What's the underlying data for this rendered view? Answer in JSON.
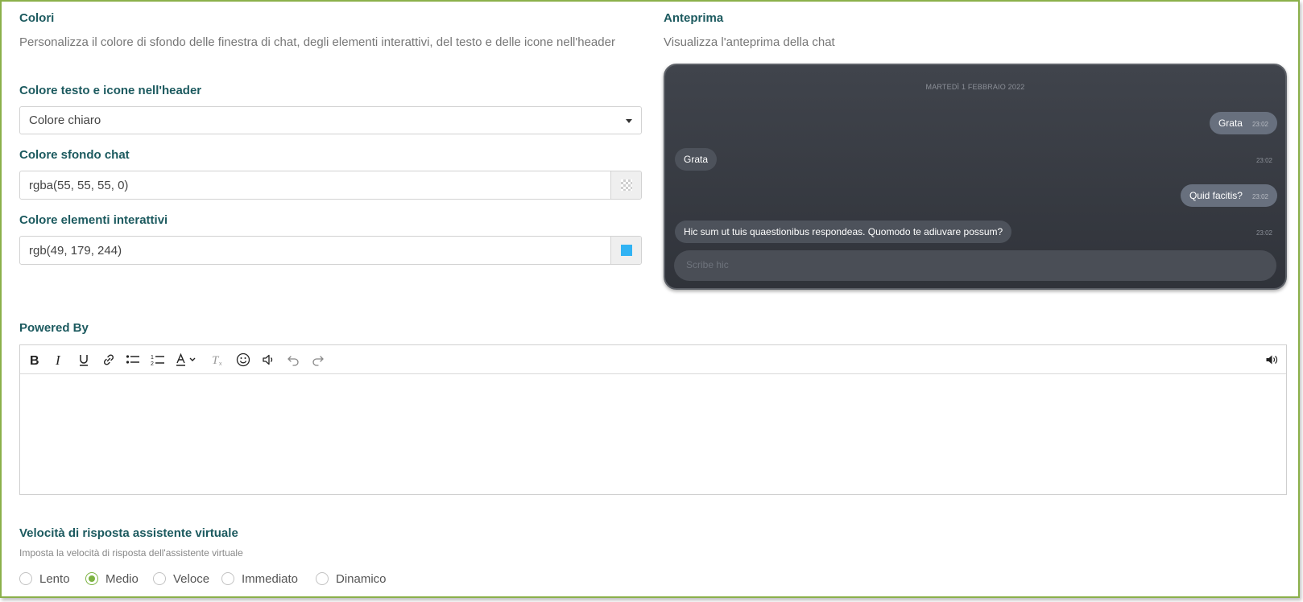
{
  "colors": {
    "title": "Colori",
    "description": "Personalizza il colore di sfondo delle finestra di chat, degli elementi interattivi, del testo e delle icone nell'header",
    "header_color": {
      "label": "Colore testo e icone nell'header",
      "selected": "Colore chiaro"
    },
    "chat_bg": {
      "label": "Colore sfondo chat",
      "value": "rgba(55, 55, 55, 0)"
    },
    "interactive": {
      "label": "Colore elementi interattivi",
      "value": "rgb(49, 179, 244)",
      "swatch": "#31b3f4"
    }
  },
  "preview": {
    "title": "Anteprima",
    "description": "Visualizza l'anteprima della chat",
    "date": "MARTEDÌ 1 FEBBRAIO 2022",
    "messages": [
      {
        "from": "user",
        "text": "Grata",
        "time": "23:02"
      },
      {
        "from": "bot",
        "text": "Grata",
        "time": "23:02"
      },
      {
        "from": "user",
        "text": "Quid facitis?",
        "time": "23:02"
      },
      {
        "from": "bot",
        "text": "Hic sum ut tuis quaestionibus respondeas. Quomodo te adiuvare possum?",
        "time": "23:02"
      }
    ],
    "input_placeholder": "Scribe hic"
  },
  "powered_by": {
    "title": "Powered By",
    "toolbar": [
      "bold-icon",
      "italic-icon",
      "underline-icon",
      "link-icon",
      "bullet-list-icon",
      "numbered-list-icon",
      "font-color-icon",
      "clear-format-icon",
      "emoji-icon",
      "speaker-icon",
      "undo-icon",
      "redo-icon",
      "volume-icon"
    ]
  },
  "speed": {
    "title": "Velocità di risposta assistente virtuale",
    "description": "Imposta la velocità di risposta dell'assistente virtuale",
    "options": [
      "Lento",
      "Medio",
      "Veloce",
      "Immediato",
      "Dinamico"
    ],
    "selected": "Medio"
  },
  "accent": "#7cb342"
}
